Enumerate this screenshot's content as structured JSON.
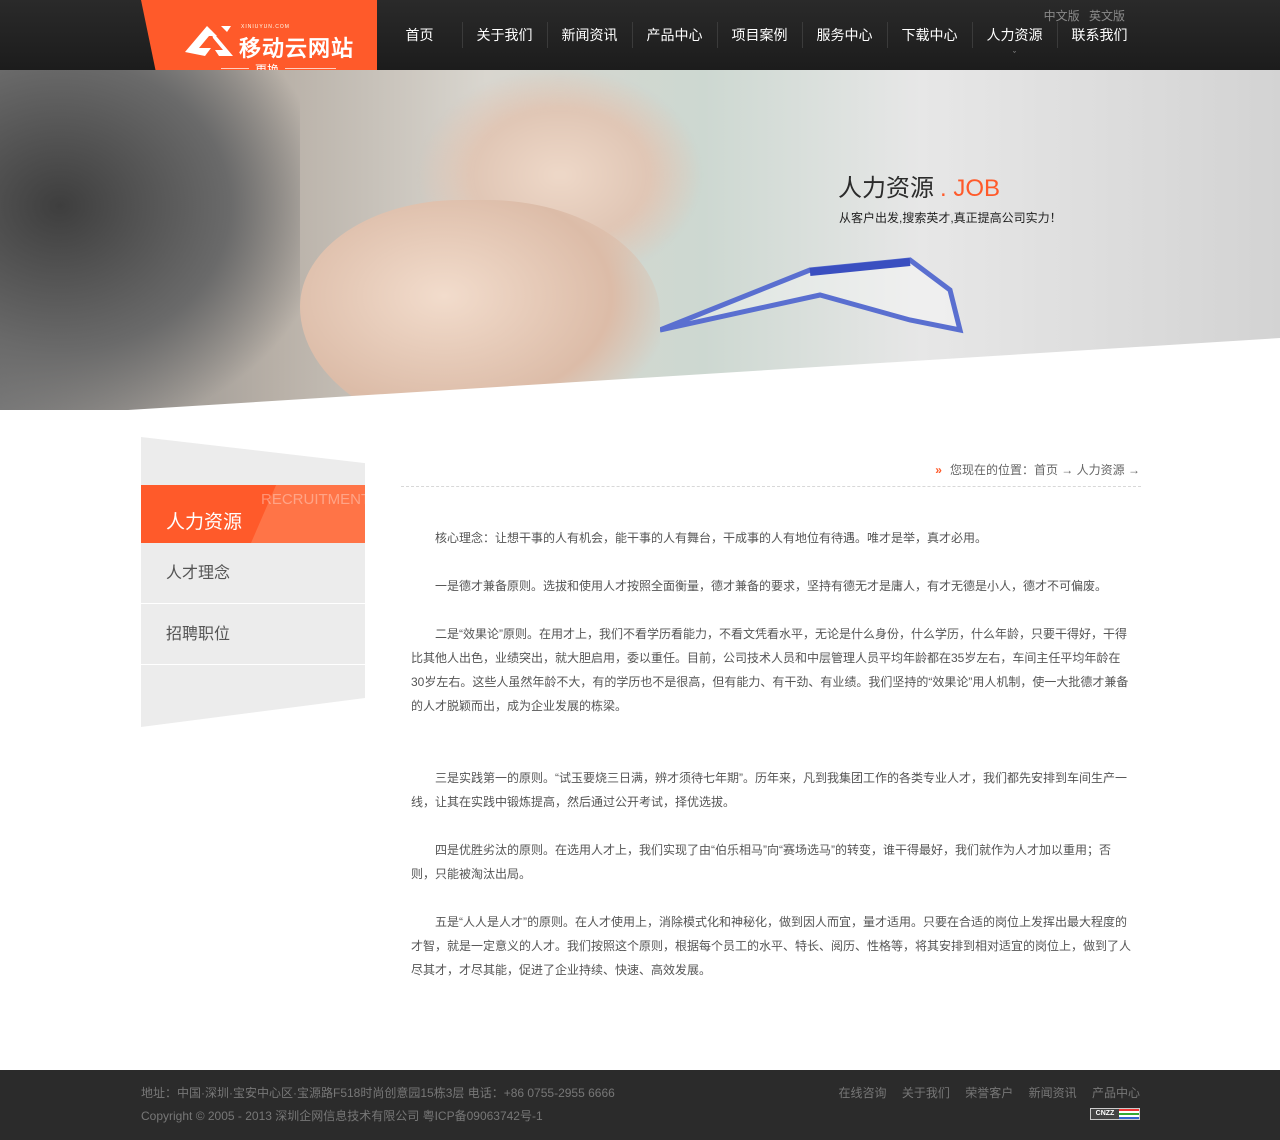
{
  "header": {
    "logo_tiny": "XINIUYUN.COM",
    "logo_text": "移动云网站",
    "logo_change": "更换",
    "lang": [
      "中文版",
      "英文版"
    ],
    "nav": [
      "首页",
      "关于我们",
      "新闻资讯",
      "产品中心",
      "项目案例",
      "服务中心",
      "下载中心",
      "人力资源",
      "联系我们"
    ],
    "active_nav": "人力资源",
    "active_caret": "ˇ"
  },
  "banner": {
    "title_cn": "人力资源",
    "title_en": ". JOB",
    "subtitle": "从客户出发,搜索英才,真正提高公司实力！"
  },
  "sidebar": {
    "title": "人力资源",
    "title_en": "RECRUITMENT",
    "items": [
      "人才理念",
      "招聘职位"
    ]
  },
  "breadcrumb": {
    "arrows": "»",
    "prefix": "您现在的位置：",
    "home": "首页",
    "sep": " → ",
    "current": "人力资源",
    "tail": " →"
  },
  "content": {
    "paragraphs": [
      "核心理念：让想干事的人有机会，能干事的人有舞台，干成事的人有地位有待遇。唯才是举，真才必用。",
      "一是德才兼备原则。选拔和使用人才按照全面衡量，德才兼备的要求，坚持有德无才是庸人，有才无德是小人，德才不可偏废。",
      "二是“效果论”原则。在用才上，我们不看学历看能力，不看文凭看水平，无论是什么身份，什么学历，什么年龄，只要干得好，干得比其他人出色，业绩突出，就大胆启用，委以重任。目前，公司技术人员和中层管理人员平均年龄都在35岁左右，车间主任平均年龄在30岁左右。这些人虽然年龄不大，有的学历也不是很高，但有能力、有干劲、有业绩。我们坚持的“效果论”用人机制，使一大批德才兼备的人才脱颖而出，成为企业发展的栋梁。",
      "三是实践第一的原则。“试玉要烧三日满，辨才须待七年期”。历年来，凡到我集团工作的各类专业人才，我们都先安排到车间生产一线，让其在实践中锻炼提高，然后通过公开考试，择优选拔。",
      "四是优胜劣汰的原则。在选用人才上，我们实现了由“伯乐相马”向“赛场选马”的转变，谁干得最好，我们就作为人才加以重用；否则，只能被淘汰出局。",
      "五是“人人是人才”的原则。在人才使用上，消除模式化和神秘化，做到因人而宜，量才适用。只要在合适的岗位上发挥出最大程度的才智，就是一定意义的人才。我们按照这个原则，根据每个员工的水平、特长、阅历、性格等，将其安排到相对适宜的岗位上，做到了人尽其才，才尽其能，促进了企业持续、快速、高效发展。"
    ]
  },
  "footer": {
    "address": "地址：中国·深圳·宝安中心区·宝源路F518时尚创意园15栋3层 电话：+86 0755-2955 6666",
    "copyright": "Copyright © 2005 - 2013 深圳企网信息技术有限公司 粤ICP备09063742号-1",
    "links": [
      "在线咨询",
      "关于我们",
      "荣誉客户",
      "新闻资讯",
      "产品中心"
    ],
    "badge": "CNZZ"
  },
  "colors": {
    "accent": "#ff5a2a",
    "header_bg": "#222222",
    "footer_bg": "#2b2b2b",
    "sidebar_bg": "#ececec"
  }
}
